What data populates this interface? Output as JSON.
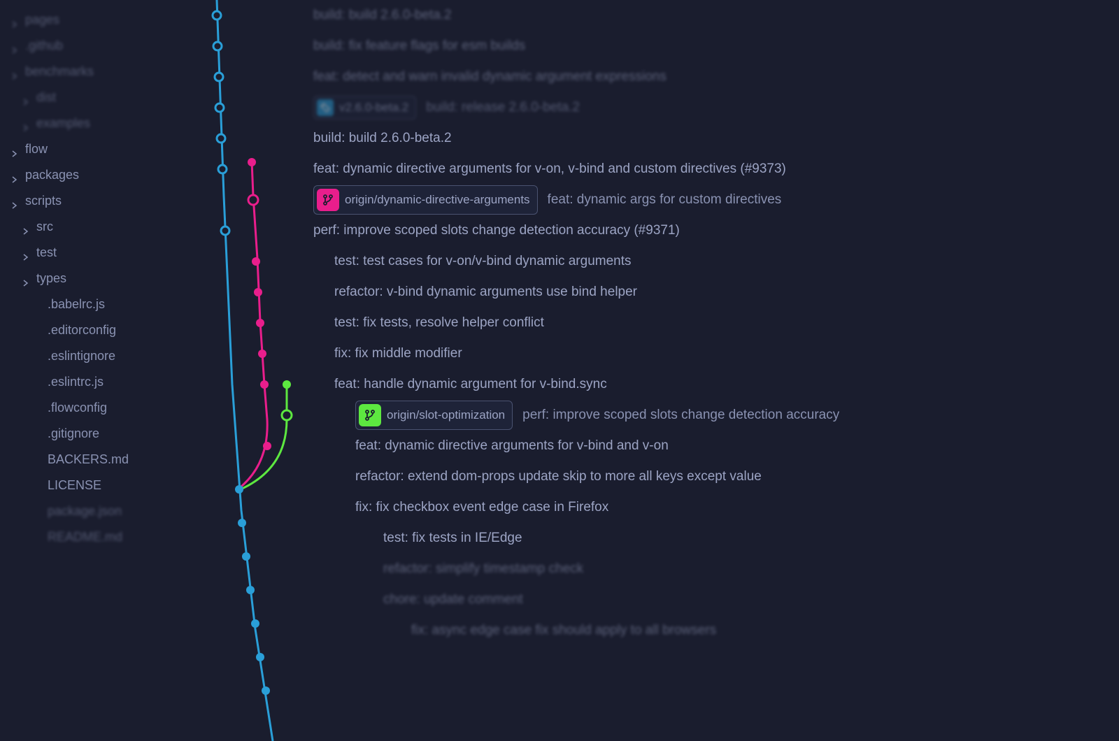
{
  "colors": {
    "background": "#1a1d2e",
    "text": "#8a92b2",
    "line_blue": "#2a9fd8",
    "line_pink": "#e91e8c",
    "line_green": "#5de840"
  },
  "sidebar": {
    "items": [
      {
        "label": "pages",
        "chevron": true,
        "blurred": true,
        "indent": 0
      },
      {
        "label": ".github",
        "chevron": true,
        "blurred": true,
        "indent": 0
      },
      {
        "label": "benchmarks",
        "chevron": true,
        "blurred": true,
        "indent": 0
      },
      {
        "label": "dist",
        "chevron": true,
        "blurred": true,
        "indent": 1
      },
      {
        "label": "examples",
        "chevron": true,
        "blurred": true,
        "indent": 1
      },
      {
        "label": "flow",
        "chevron": true,
        "blurred": false,
        "indent": 0
      },
      {
        "label": "packages",
        "chevron": true,
        "blurred": false,
        "indent": 0
      },
      {
        "label": "scripts",
        "chevron": true,
        "blurred": false,
        "indent": 0
      },
      {
        "label": "src",
        "chevron": true,
        "blurred": false,
        "indent": 1
      },
      {
        "label": "test",
        "chevron": true,
        "blurred": false,
        "indent": 1
      },
      {
        "label": "types",
        "chevron": true,
        "blurred": false,
        "indent": 1
      },
      {
        "label": ".babelrc.js",
        "chevron": false,
        "blurred": false,
        "indent": 2
      },
      {
        "label": ".editorconfig",
        "chevron": false,
        "blurred": false,
        "indent": 2
      },
      {
        "label": ".eslintignore",
        "chevron": false,
        "blurred": false,
        "indent": 2
      },
      {
        "label": ".eslintrc.js",
        "chevron": false,
        "blurred": false,
        "indent": 2
      },
      {
        "label": ".flowconfig",
        "chevron": false,
        "blurred": false,
        "indent": 2
      },
      {
        "label": ".gitignore",
        "chevron": false,
        "blurred": false,
        "indent": 2
      },
      {
        "label": "BACKERS.md",
        "chevron": false,
        "blurred": false,
        "indent": 2
      },
      {
        "label": "LICENSE",
        "chevron": false,
        "blurred": false,
        "indent": 2
      },
      {
        "label": "package.json",
        "chevron": false,
        "blurred": true,
        "indent": 2
      },
      {
        "label": "README.md",
        "chevron": false,
        "blurred": true,
        "indent": 2
      }
    ]
  },
  "commits": [
    {
      "msg": "build: build 2.6.0-beta.2",
      "blurred": true,
      "indent": 0
    },
    {
      "msg": "build: fix feature flags for esm builds",
      "blurred": true,
      "indent": 0
    },
    {
      "msg": "feat: detect and warn invalid dynamic argument expressions",
      "blurred": true,
      "indent": 0
    },
    {
      "tag": "v2.6.0-beta.2",
      "msg": "build: release 2.6.0-beta.2",
      "blurred": true,
      "indent": 0
    },
    {
      "msg": "build: build 2.6.0-beta.2",
      "blurred": false,
      "indent": 0
    },
    {
      "msg": "feat: dynamic directive arguments for v-on, v-bind and custom directives (#9373)",
      "blurred": false,
      "indent": 0
    },
    {
      "branch": "origin/dynamic-directive-arguments",
      "branch_color": "pink",
      "msg": "feat: dynamic args for custom directives",
      "blurred": false,
      "indent": 0
    },
    {
      "msg": "perf: improve scoped slots change detection accuracy (#9371)",
      "blurred": false,
      "indent": 0
    },
    {
      "msg": "test: test cases for v-on/v-bind dynamic arguments",
      "blurred": false,
      "indent": 1
    },
    {
      "msg": "refactor: v-bind dynamic arguments use bind helper",
      "blurred": false,
      "indent": 1
    },
    {
      "msg": "test: fix tests, resolve helper conflict",
      "blurred": false,
      "indent": 1
    },
    {
      "msg": "fix: fix middle modifier",
      "blurred": false,
      "indent": 1
    },
    {
      "msg": "feat: handle dynamic argument for v-bind.sync",
      "blurred": false,
      "indent": 1
    },
    {
      "branch": "origin/slot-optimization",
      "branch_color": "green",
      "msg": "perf: improve scoped slots change detection accuracy",
      "blurred": false,
      "indent": 2
    },
    {
      "msg": "feat: dynamic directive arguments for v-bind and v-on",
      "blurred": false,
      "indent": 2
    },
    {
      "msg": "refactor: extend dom-props update skip to more all keys except value",
      "blurred": false,
      "indent": 2
    },
    {
      "msg": "fix: fix checkbox event edge case in Firefox",
      "blurred": false,
      "indent": 2
    },
    {
      "msg": "test: fix tests in IE/Edge",
      "blurred": false,
      "indent": 3
    },
    {
      "msg": "refactor: simplify timestamp check",
      "blurred": true,
      "indent": 3
    },
    {
      "msg": "chore: update comment",
      "blurred": true,
      "indent": 3
    },
    {
      "msg": "fix: async edge case fix should apply to all browsers",
      "blurred": true,
      "indent": 4
    }
  ]
}
